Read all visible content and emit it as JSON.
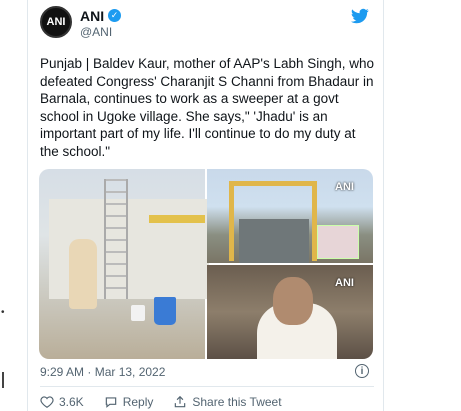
{
  "tweet": {
    "author_name": "ANI",
    "author_handle": "@ANI",
    "avatar_text": "ANI",
    "text": "Punjab | Baldev Kaur, mother of AAP's Labh Singh, who defeated Congress' Charanjit S Channi from Bhadaur in Barnala, continues to work as a sweeper at a govt school in Ugoke village. She says,\" 'Jhadu' is an important part of my life. I'll continue to do my duty at the school.\"",
    "timestamp": "9:29 AM · Mar 13, 2022",
    "watermarks": [
      "ANI",
      "ANI"
    ],
    "actions": {
      "likes": "3.6K",
      "reply": "Reply",
      "share": "Share this Tweet"
    }
  },
  "colors": {
    "brand_blue": "#1d9bf0",
    "muted_text": "#536471",
    "like_red": "#f91880"
  },
  "icons": [
    "verified-icon",
    "twitter-bird-icon",
    "info-icon",
    "heart-icon",
    "reply-icon",
    "share-icon"
  ]
}
